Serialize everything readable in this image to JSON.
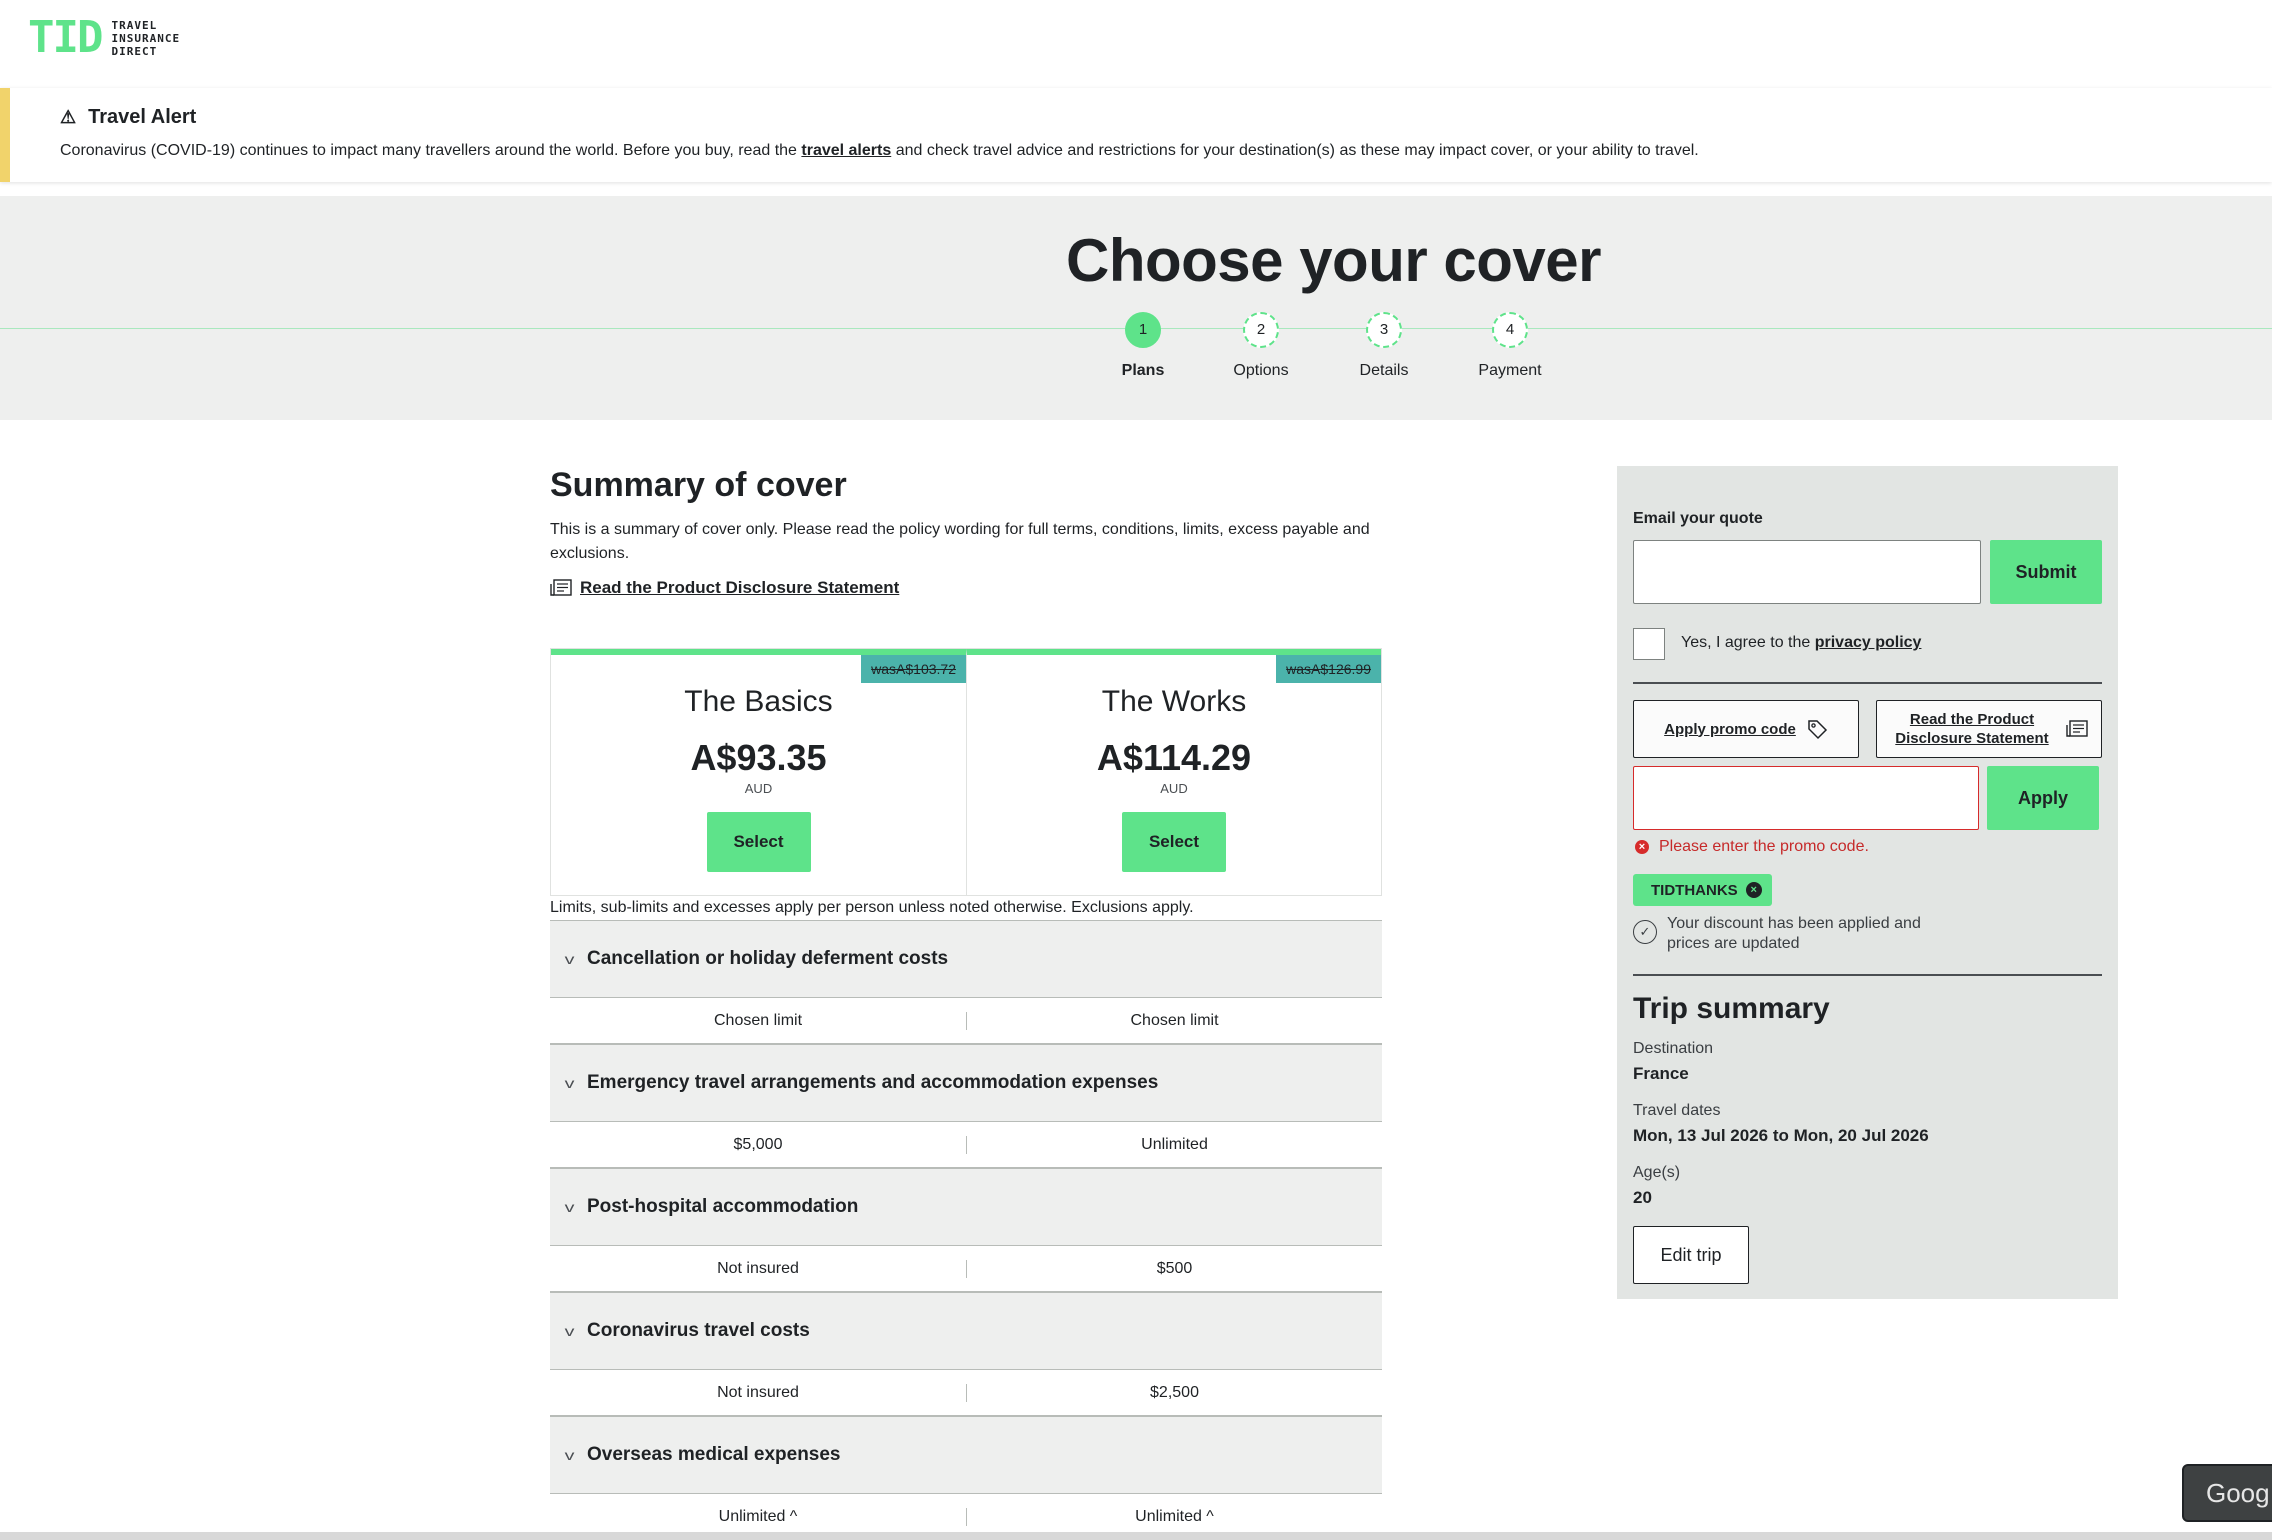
{
  "brand": {
    "mark": "TID",
    "lines": [
      "TRAVEL",
      "INSURANCE",
      "DIRECT"
    ]
  },
  "alert": {
    "title": "Travel Alert",
    "text_before": "Coronavirus (COVID-19) continues to impact many travellers around the world. Before you buy, read the",
    "link": "travel alerts",
    "text_after": "and check travel advice and restrictions for your destination(s) as these may impact cover, or your ability to travel."
  },
  "hero": {
    "title": "Choose your cover",
    "steps": [
      {
        "num": "1",
        "label": "Plans",
        "active": true
      },
      {
        "num": "2",
        "label": "Options",
        "active": false
      },
      {
        "num": "3",
        "label": "Details",
        "active": false
      },
      {
        "num": "4",
        "label": "Payment",
        "active": false
      }
    ]
  },
  "summary": {
    "title": "Summary of cover",
    "intro": "This is a summary of cover only. Please read the policy wording for full terms, conditions, limits, excess payable and exclusions.",
    "pds_link": "Read the Product Disclosure Statement",
    "limits_note": "Limits, sub-limits and excesses apply per person unless noted otherwise. Exclusions apply."
  },
  "plans": [
    {
      "name": "The Basics",
      "was": "wasA$103.72",
      "price": "A$93.35",
      "currency": "AUD",
      "select": "Select"
    },
    {
      "name": "The Works",
      "was": "wasA$126.99",
      "price": "A$114.29",
      "currency": "AUD",
      "select": "Select"
    }
  ],
  "coverage": [
    {
      "title": "Cancellation or holiday deferment costs",
      "basics": "Chosen limit",
      "works": "Chosen limit"
    },
    {
      "title": "Emergency travel arrangements and accommodation expenses",
      "basics": "$5,000",
      "works": "Unlimited"
    },
    {
      "title": "Post-hospital accommodation",
      "basics": "Not insured",
      "works": "$500"
    },
    {
      "title": "Coronavirus travel costs",
      "basics": "Not insured",
      "works": "$2,500"
    },
    {
      "title": "Overseas medical expenses",
      "basics": "Unlimited ^",
      "works": "Unlimited ^"
    }
  ],
  "sidebar": {
    "email_label": "Email your quote",
    "submit": "Submit",
    "agree_text": "Yes, I agree to the",
    "privacy_link": "privacy policy",
    "promo_btn": "Apply promo code",
    "pds_btn": "Read the Product Disclosure Statement",
    "apply": "Apply",
    "error": "Please enter the promo code.",
    "promo_chip": "TIDTHANKS",
    "discount_msg": "Your discount has been applied and prices are updated",
    "trip_title": "Trip summary",
    "destination_label": "Destination",
    "destination": "France",
    "dates_label": "Travel dates",
    "dates": "Mon, 13 Jul 2026 to Mon, 20 Jul 2026",
    "ages_label": "Age(s)",
    "ages": "20",
    "edit": "Edit trip"
  },
  "google_btn": "Goog",
  "colors": {
    "accent": "#5ee38a",
    "teal": "#4bb3ab",
    "alert": "#f1d36b",
    "error": "#d62b2b"
  }
}
